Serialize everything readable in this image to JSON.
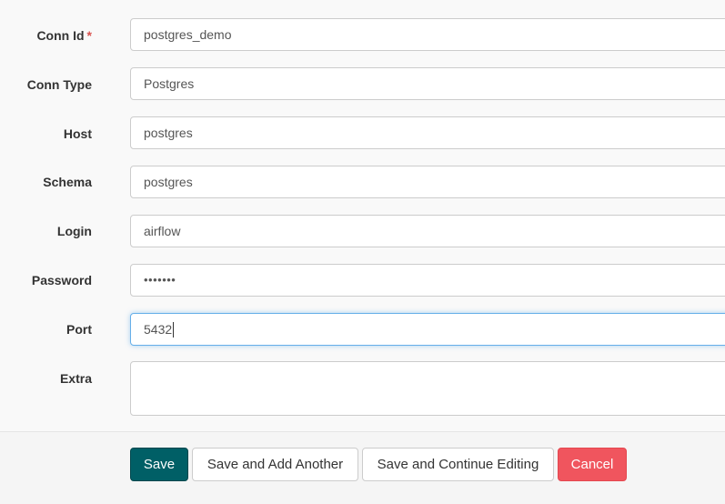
{
  "form": {
    "fields": {
      "conn_id": {
        "label": "Conn Id",
        "required_mark": "*",
        "value": "postgres_demo"
      },
      "conn_type": {
        "label": "Conn Type",
        "value": "Postgres"
      },
      "host": {
        "label": "Host",
        "value": "postgres"
      },
      "schema": {
        "label": "Schema",
        "value": "postgres"
      },
      "login": {
        "label": "Login",
        "value": "airflow"
      },
      "password": {
        "label": "Password",
        "value": "•••••••"
      },
      "port": {
        "label": "Port",
        "value": "5432"
      },
      "extra": {
        "label": "Extra",
        "value": ""
      }
    }
  },
  "actions": {
    "save": "Save",
    "save_add_another": "Save and Add Another",
    "save_continue": "Save and Continue Editing",
    "cancel": "Cancel"
  },
  "colors": {
    "save_button": "#005f66",
    "cancel_button": "#f0555e",
    "required_mark": "#d9534f",
    "focus_border": "#66afe9"
  }
}
